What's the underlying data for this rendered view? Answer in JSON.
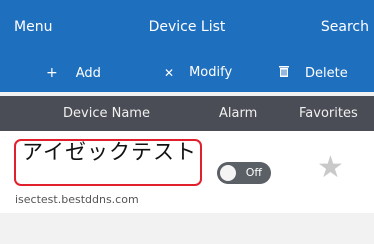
{
  "header": {
    "menu_label": "Menu",
    "title": "Device List",
    "search_label": "Search"
  },
  "toolbar": {
    "add_label": "Add",
    "add_icon": "plus-icon",
    "modify_label": "Modify",
    "modify_icon": "cross-icon",
    "delete_label": "Delete",
    "delete_icon": "trash-icon"
  },
  "columns": {
    "name": "Device Name",
    "alarm": "Alarm",
    "favorites": "Favorites"
  },
  "devices": [
    {
      "name": "アイゼックテスト",
      "host": "isectest.bestddns.com",
      "alarm": "Off",
      "favorite": false
    }
  ],
  "colors": {
    "primary": "#1f6fbf",
    "header_bar": "#4a4d55",
    "highlight": "#e0202a"
  }
}
